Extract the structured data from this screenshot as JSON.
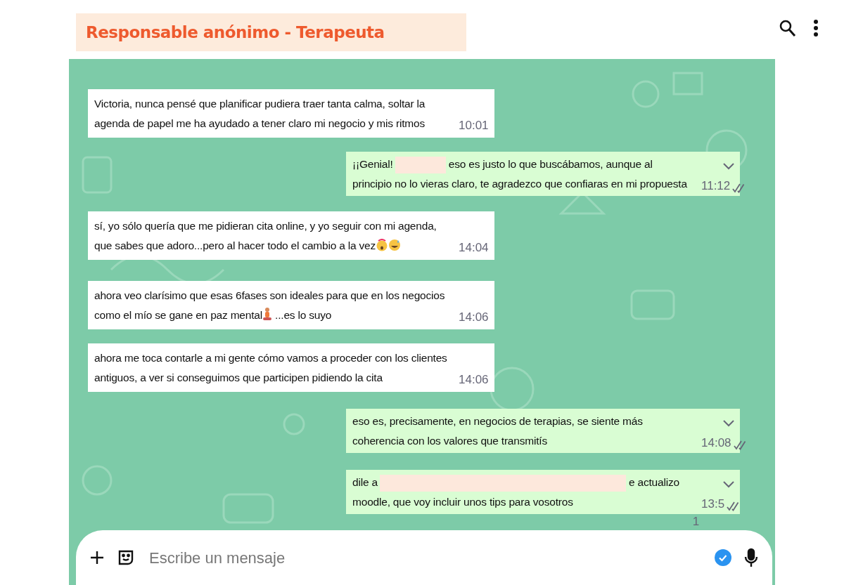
{
  "header": {
    "title": "Responsable anónimo - Terapeuta"
  },
  "messages": [
    {
      "kind": "received",
      "parts": [
        {
          "kind": "text",
          "text": "Victoria, nunca pensé que planificar pudiera traer tanta calma, soltar la agenda de papel me ha ayudado a tener claro mi negocio y mis ritmos"
        }
      ],
      "time": "10:01"
    },
    {
      "kind": "sent",
      "parts": [
        {
          "kind": "text",
          "text": "¡¡Genial!"
        },
        {
          "kind": "redacted"
        },
        {
          "kind": "text",
          "text": "eso es justo lo que buscábamos, aunque al principio no lo vieras claro, te agradezco que confiaras en mi propuesta"
        }
      ],
      "time": "11:12"
    },
    {
      "kind": "received",
      "parts": [
        {
          "kind": "text",
          "text": "sí, yo sólo quería que me pidieran cita online, y yo seguir con mi agenda, que sabes que adoro...pero al hacer todo el cambio a la vez"
        },
        {
          "kind": "shockface"
        },
        {
          "kind": "sweatface"
        }
      ],
      "time": "14:04"
    },
    {
      "kind": "received",
      "parts": [
        {
          "kind": "text",
          "text": "ahora veo clarísimo que esas 6fases son ideales para que en los negocios como el mío se gane en paz mental"
        },
        {
          "kind": "meditator"
        },
        {
          "kind": "text",
          "text": "...es lo suyo"
        }
      ],
      "time": "14:06"
    },
    {
      "kind": "received",
      "parts": [
        {
          "kind": "text",
          "text": "ahora me toca contarle a mi gente cómo vamos a proceder con los clientes antiguos, a ver si conseguimos que participen pidiendo la cita"
        }
      ],
      "time": "14:06"
    },
    {
      "kind": "sent",
      "parts": [
        {
          "kind": "text",
          "text": "eso es, precisamente, en negocios de terapias, se siente más coherencia con los valores que transmitís"
        }
      ],
      "time": "14:08"
    },
    {
      "kind": "sent",
      "parts": [
        {
          "kind": "text",
          "text": "dile a"
        },
        {
          "kind": "redacted"
        },
        {
          "kind": "text",
          "text": "e actualizo moodle, que voy incluir unos tips para vosotros"
        }
      ],
      "time": "13:5",
      "time_overflow": "1"
    }
  ],
  "composer": {
    "placeholder": "Escribe un mensaje"
  }
}
